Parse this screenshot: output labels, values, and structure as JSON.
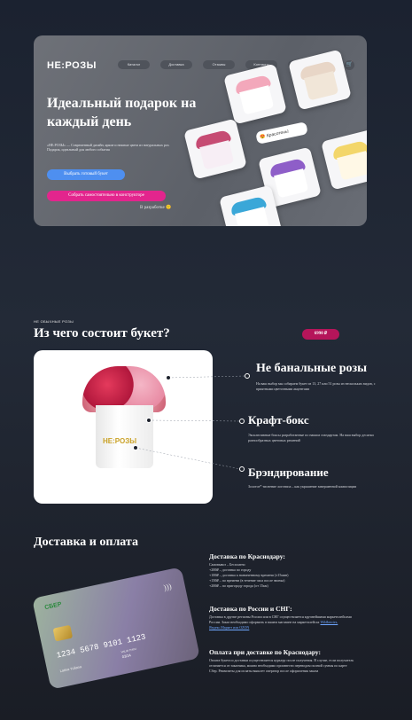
{
  "hero": {
    "logo": "НЕ:РОЗЫ",
    "nav": [
      "Каталог",
      "Доставка",
      "Отзывы",
      "Контакты",
      "LUXURY"
    ],
    "cart_icon": "cart-icon",
    "title": "Идеальный подарок на каждый день",
    "description": "«НЕ:РОЗЫ» — Современный дизайн, яркие и нежные цвета из натуральных роз. Подарок, идеальный для любого события",
    "button_ready": "Выбрать готовый букет",
    "button_constructor": "Собрать самостоятельно в конструкторе",
    "in_development": "В разработке",
    "tag": "Красотень!"
  },
  "composition": {
    "label": "НЕ ОБЫЧНЫЕ РОЗЫ",
    "title": "Из чего состоит букет?",
    "price": "6990 ₽",
    "box_logo": "НЕ:РОЗЫ",
    "features": [
      {
        "title": "Не банальные розы",
        "text": "На ваш выбор мы собираем букет из 13, 27 или 51 розы из нескольких видов, с приятными цветочными акцентами"
      },
      {
        "title": "Крафт-бокс",
        "text": "Эксклюзивные боксы разработанные по нашим стандартам. На ваш выбор десятки разнообразных цветовых решений"
      },
      {
        "title": "Брэндирование",
        "text": "Золотое* тиснение логотипа – как украшение завершенной композиции"
      }
    ]
  },
  "delivery": {
    "title": "Доставка и оплата",
    "card": {
      "bank": "СБЕР",
      "number": "1234 5678 9101 1123",
      "holder": "Latisa Yuliana",
      "valid_label": "VALID THRU",
      "expiry": "03/24"
    },
    "krasnodar_title": "Доставка по Краснодару:",
    "krasnodar_lines": [
      "Самовывоз – Бесплатно",
      "+200₽ – доставка по городу",
      "+100₽ – доставка к назначенному времени (±15мин)",
      "+150₽ – по времени (в течение часа после звонка)",
      "+200₽ – по пригороду города (от 15км)"
    ],
    "russia_title": "Доставка по России и СНГ:",
    "russia_text": "Доставка в другие регионы России или в СНГ осуществляется крупнейшими маркетплейсами России. Заказ необходимо оформить в вашем магазине на маркетплейсах",
    "marketplaces": "Wildberries, Яндекс.Маркет или OZON",
    "payment_title": "Оплата при доставке по Краснодару:",
    "payment_text": "Оплата букета и доставки осуществляется курьеру после получения. В случае, если получатель отличается от заказчика, можно необходимо произвести переводом полной суммы по карте Сбер. Реквизиты для оплаты вышлет оператор после оформления заказа"
  },
  "colors": {
    "accent_blue": "#4e8ff0",
    "accent_pink": "#e3258d",
    "price_bg": "#b5155a",
    "gold": "#caa227"
  }
}
